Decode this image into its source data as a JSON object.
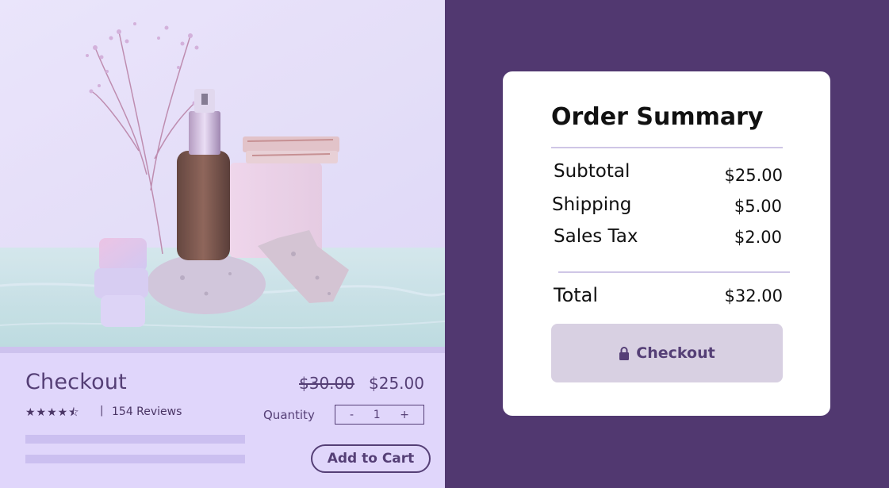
{
  "product": {
    "title": "Checkout",
    "stars_text": "★★★★⯪",
    "rating": 4.5,
    "separator": "|",
    "reviews": "154 Reviews",
    "old_price": "$30.00",
    "price": "$25.00",
    "quantity_label": "Quantity",
    "quantity_minus": "-",
    "quantity_value": "1",
    "quantity_plus": "+",
    "add_to_cart": "Add to Cart"
  },
  "summary": {
    "title": "Order Summary",
    "rows": [
      {
        "label": "Subtotal",
        "value": "$25.00"
      },
      {
        "label": "Shipping",
        "value": "$5.00"
      },
      {
        "label": "Sales Tax",
        "value": "$2.00"
      }
    ],
    "total_label": "Total",
    "total_value": "$32.00",
    "checkout_label": "Checkout"
  },
  "colors": {
    "background": "#513870",
    "accent": "#553f76",
    "panel": "#e0d6fb",
    "card": "#ffffff",
    "button": "#d8d0e2"
  },
  "icons": [
    "lock-icon",
    "star-icon"
  ]
}
